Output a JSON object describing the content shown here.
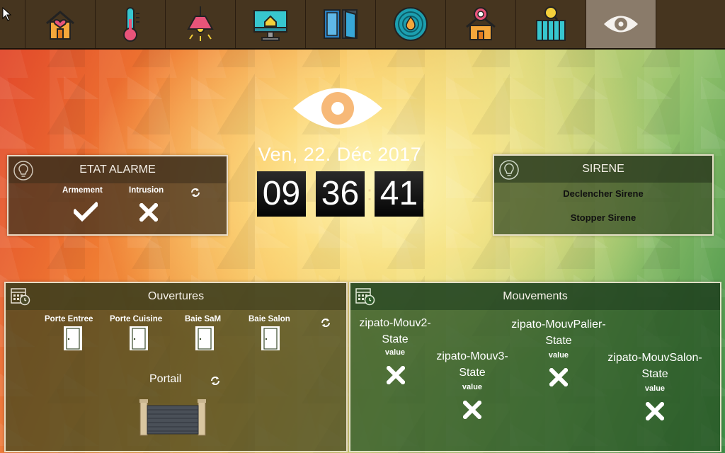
{
  "nav": {
    "items": [
      {
        "icon": "home-heart-icon"
      },
      {
        "icon": "thermometer-icon"
      },
      {
        "icon": "ceiling-lamp-icon"
      },
      {
        "icon": "computer-home-icon"
      },
      {
        "icon": "door-window-icon"
      },
      {
        "icon": "radar-fire-icon"
      },
      {
        "icon": "home-gear-icon"
      },
      {
        "icon": "radiator-search-icon"
      },
      {
        "icon": "eye-icon",
        "active": true
      }
    ]
  },
  "header": {
    "date": "Ven, 22. Déc 2017",
    "clock": {
      "hours": "09",
      "minutes": "36",
      "seconds": "41",
      "separator": ":"
    }
  },
  "alarme": {
    "title": "ETAT ALARME",
    "armement_label": "Armement",
    "armement_state": "check",
    "intrusion_label": "Intrusion",
    "intrusion_state": "cross"
  },
  "sirene": {
    "title": "SIRENE",
    "declencher_label": "Declencher Sirene",
    "stopper_label": "Stopper Sirene"
  },
  "ouvertures": {
    "title": "Ouvertures",
    "doors": [
      {
        "label": "Porte Entree"
      },
      {
        "label": "Porte Cuisine"
      },
      {
        "label": "Baie SaM"
      },
      {
        "label": "Baie Salon"
      }
    ],
    "portail_label": "Portail"
  },
  "mouvements": {
    "title": "Mouvements",
    "sensors": [
      {
        "name_line1": "zipato-Mouv2-",
        "name_line2": "State",
        "value_label": "value",
        "state": "cross"
      },
      {
        "name_line1": "zipato-Mouv3-",
        "name_line2": "State",
        "value_label": "value",
        "state": "cross"
      },
      {
        "name_line1": "zipato-MouvPalier-",
        "name_line2": "State",
        "value_label": "value",
        "state": "cross"
      },
      {
        "name_line1": "zipato-MouvSalon-",
        "name_line2": "State",
        "value_label": "value",
        "state": "cross"
      }
    ]
  },
  "colors": {
    "topbar": "#46351f",
    "active_tab": "#8a7b6a",
    "accent": "#f4a73b"
  }
}
